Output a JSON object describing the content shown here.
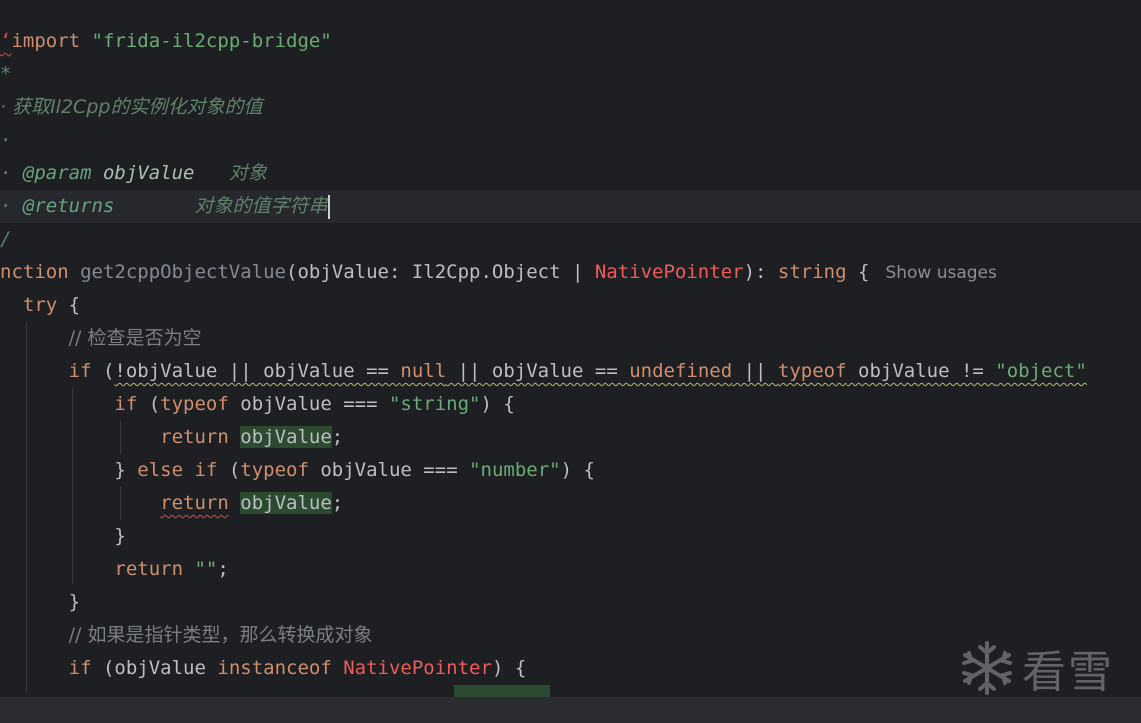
{
  "editor": {
    "lines": {
      "l1": {
        "kw": "import",
        "str": "\"frida-il2cpp-bridge\"",
        "prefix": "ʻ"
      },
      "l2": {
        "text": "*"
      },
      "l3": {
        "text": "· 获取Il2Cpp的实例化对象的值"
      },
      "l4": {
        "text": "·"
      },
      "l5": {
        "bullet": "· ",
        "tag": "@param",
        "param": "objValue",
        "desc": "对象"
      },
      "l6": {
        "bullet": "· ",
        "tag": "@returns",
        "desc": "对象的值字符串"
      },
      "l7": {
        "text": "/"
      },
      "l8": {
        "kw": "nction",
        "name": "get2cppObjectValue",
        "open": "(objValue: Il2Cpp.Object | ",
        "np": "NativePointer",
        "close": "): ",
        "ret": "string",
        "brace": " {",
        "hint": "Show usages"
      },
      "l9": {
        "kw": "try",
        "rest": " {"
      },
      "l10": {
        "text": "// 检查是否为空"
      },
      "l11": {
        "kw": "if",
        "p1": " (",
        "p2": "!objValue || objValue == ",
        "null": "null",
        "p3": " || objValue == ",
        "undef": "undefined",
        "p4": " || ",
        "typeof": "typeof",
        "p5": " objValue != ",
        "str": "\"object\""
      },
      "l12": {
        "kw": "if",
        "p1": " (",
        "typeof": "typeof",
        "p2": " objValue === ",
        "str": "\"string\"",
        "p3": ") {"
      },
      "l13": {
        "kw": "return",
        "sp": " ",
        "val": "objValue",
        "end": ";"
      },
      "l14": {
        "p0": "} ",
        "kw1": "else",
        "sp": " ",
        "kw2": "if",
        "p1": " (",
        "typeof": "typeof",
        "p2": " objValue === ",
        "str": "\"number\"",
        "p3": ") {"
      },
      "l15": {
        "kw": "return",
        "sp": " ",
        "val": "objValue",
        "end": ";"
      },
      "l16": {
        "text": "}"
      },
      "l17": {
        "kw": "return",
        "sp": " ",
        "str": "\"\"",
        "end": ";"
      },
      "l18": {
        "text": "}"
      },
      "l19": {
        "text": "// 如果是指针类型，那么转换成对象"
      },
      "l20": {
        "kw": "if",
        "p1": " (objValue ",
        "kw2": "instanceof",
        "sp": " ",
        "np": "NativePointer",
        "p2": ") {"
      }
    }
  },
  "watermark": {
    "text": "看雪",
    "icon": "snowflake-icon"
  },
  "colors": {
    "background": "#1e1f22",
    "keyword": "#cf8e6d",
    "string": "#6aab73",
    "error": "#ee5b5b",
    "doc": "#5f826b"
  }
}
